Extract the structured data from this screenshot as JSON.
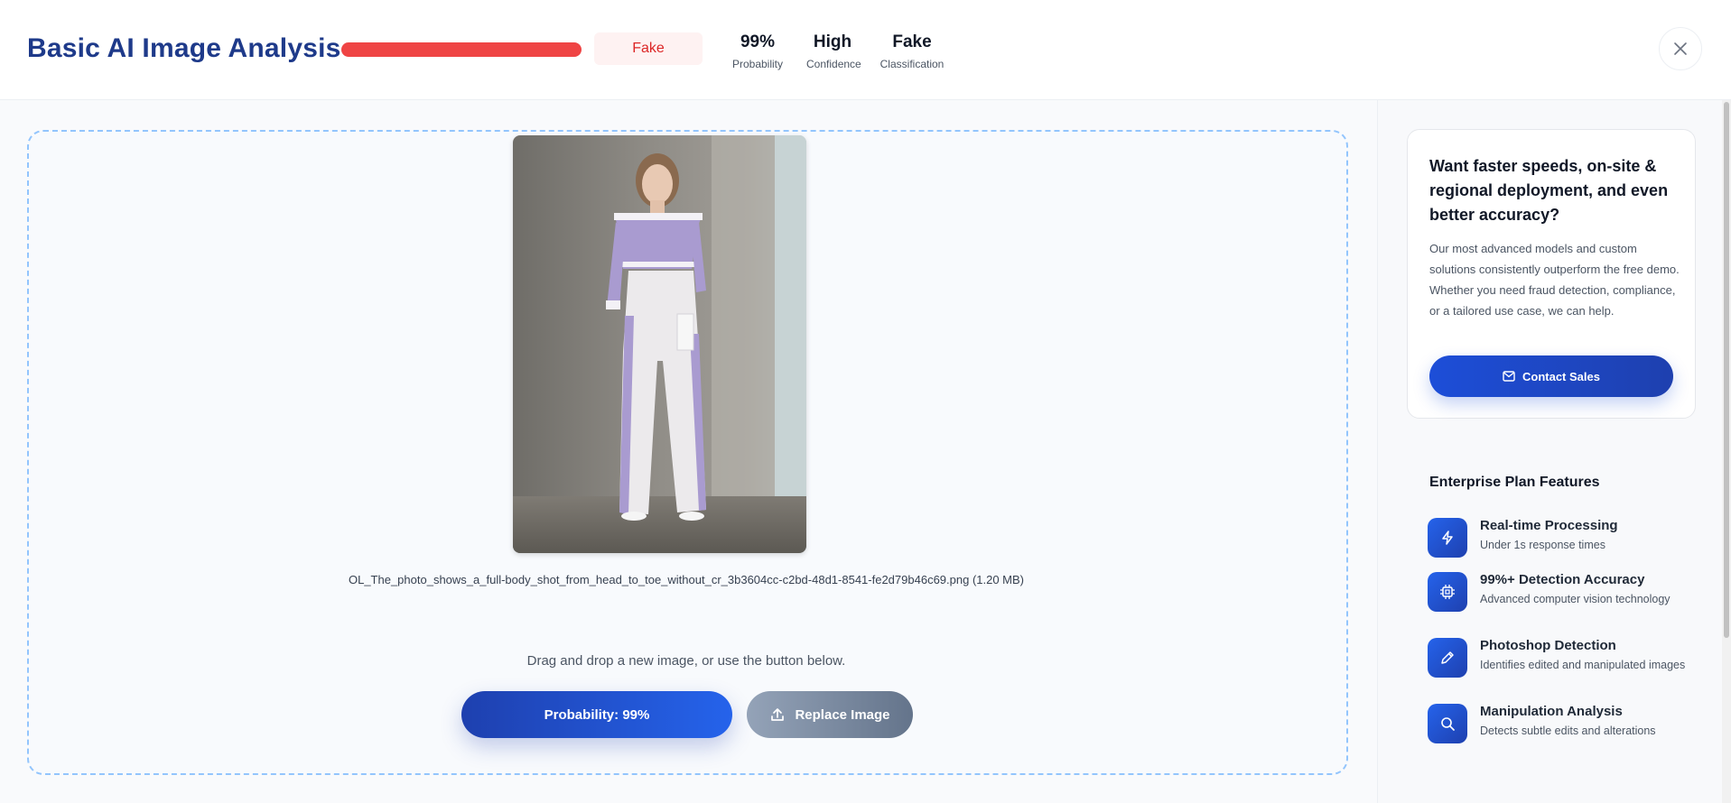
{
  "header": {
    "title": "Basic AI Image Analysis",
    "badge": "Fake",
    "stats": [
      {
        "value": "99%",
        "label": "Probability"
      },
      {
        "value": "High",
        "label": "Confidence"
      },
      {
        "value": "Fake",
        "label": "Classification"
      }
    ],
    "probability_bar_fill": 1.0,
    "colors": {
      "bar": "#ef4444",
      "badge_bg": "#fef2f2",
      "badge_text": "#dc2626",
      "title": "#1e3a8a"
    }
  },
  "upload": {
    "filename": "OL_The_photo_shows_a_full-body_shot_from_head_to_toe_without_cr_3b3604cc-c2bd-48d1-8541-fe2d79b46c69.png (1.20 MB)",
    "hint": "Drag and drop a new image, or use the button below.",
    "probability_button": "Probability: 99%",
    "replace_button": "Replace Image"
  },
  "sidebar": {
    "cta_title": "Want faster speeds, on-site & regional deployment, and even better accuracy?",
    "cta_description": "Our most advanced models and custom solutions consistently outperform the free demo. Whether you need fraud detection, compliance, or a tailored use case, we can help.",
    "contact_button": "Contact Sales",
    "features_heading": "Enterprise Plan Features",
    "features": [
      {
        "title": "Real-time Processing",
        "subtitle": "Under 1s response times",
        "icon": "lightning-icon"
      },
      {
        "title": "99%+ Detection Accuracy",
        "subtitle": "Advanced computer vision technology",
        "icon": "chip-icon"
      },
      {
        "title": "Photoshop Detection",
        "subtitle": "Identifies edited and manipulated images",
        "icon": "pencil-icon"
      },
      {
        "title": "Manipulation Analysis",
        "subtitle": "Detects subtle edits and alterations",
        "icon": "search-icon"
      }
    ],
    "accent": "#1d4ed8"
  }
}
